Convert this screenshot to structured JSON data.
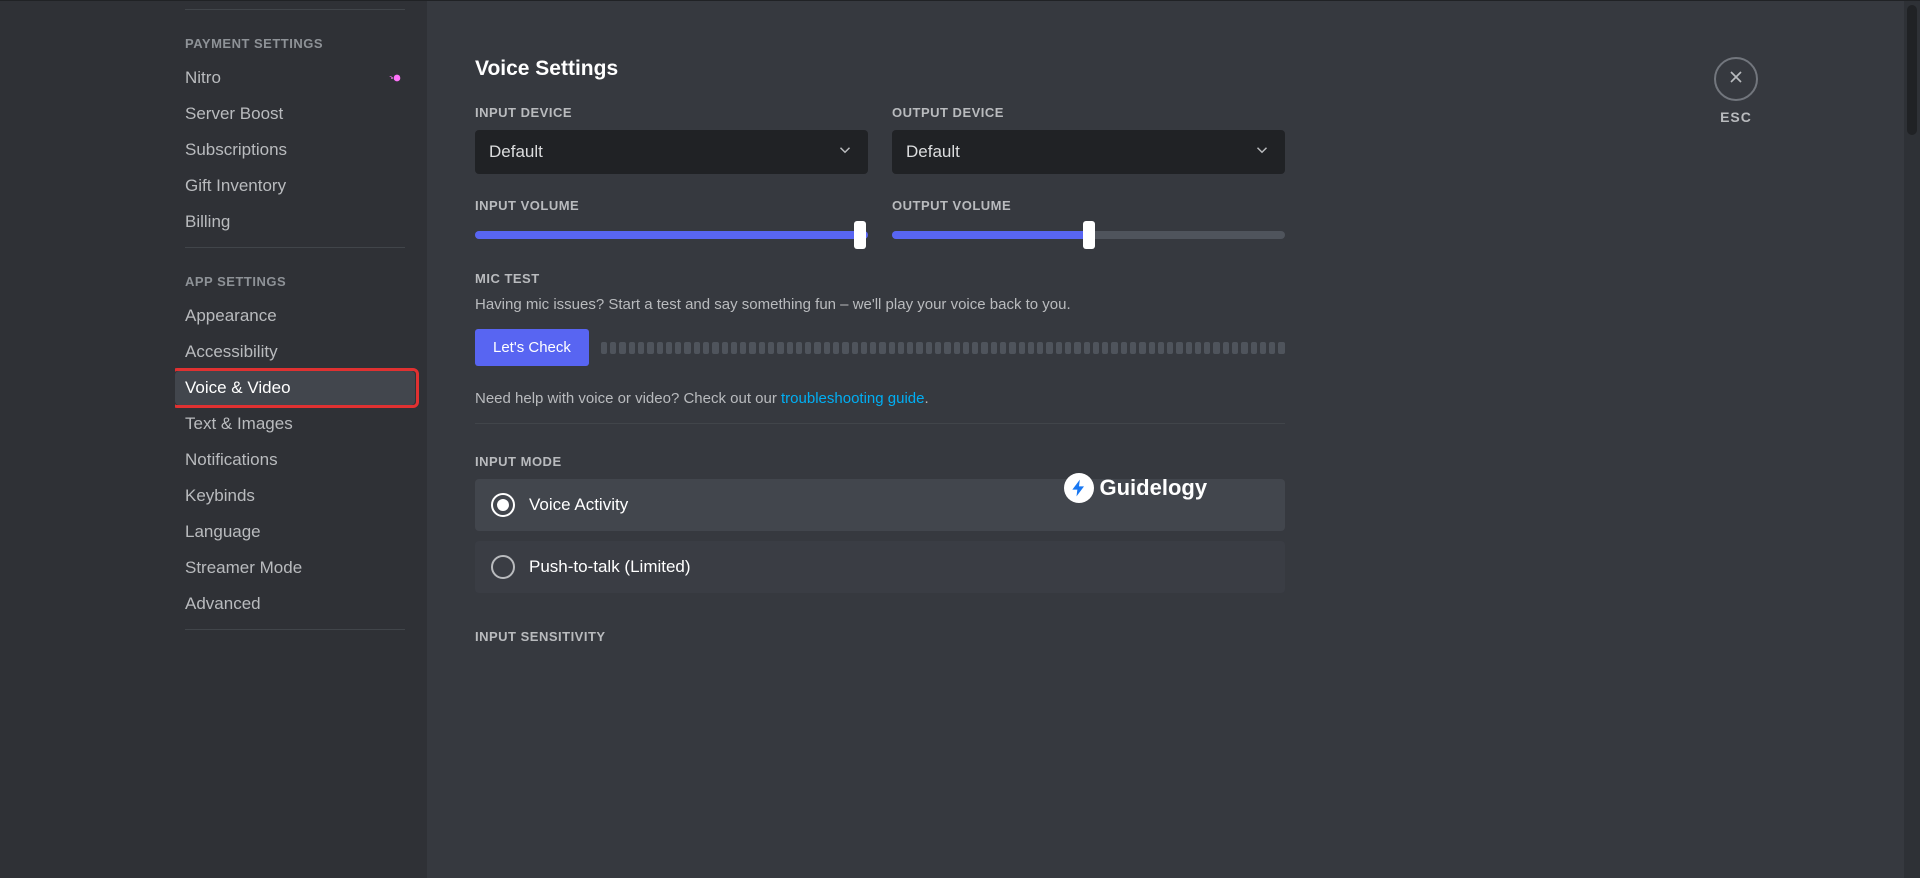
{
  "sidebar": {
    "payment_header": "PAYMENT SETTINGS",
    "app_header": "APP SETTINGS",
    "items": {
      "nitro": "Nitro",
      "server_boost": "Server Boost",
      "subscriptions": "Subscriptions",
      "gift_inventory": "Gift Inventory",
      "billing": "Billing",
      "appearance": "Appearance",
      "accessibility": "Accessibility",
      "voice_video": "Voice & Video",
      "text_images": "Text & Images",
      "notifications": "Notifications",
      "keybinds": "Keybinds",
      "language": "Language",
      "streamer_mode": "Streamer Mode",
      "advanced": "Advanced"
    }
  },
  "page": {
    "title": "Voice Settings",
    "close": "ESC"
  },
  "devices": {
    "input_label": "INPUT DEVICE",
    "input_value": "Default",
    "output_label": "OUTPUT DEVICE",
    "output_value": "Default"
  },
  "volumes": {
    "input_label": "INPUT VOLUME",
    "input_percent": 100,
    "output_label": "OUTPUT VOLUME",
    "output_percent": 50
  },
  "mic_test": {
    "header": "MIC TEST",
    "description": "Having mic issues? Start a test and say something fun – we'll play your voice back to you.",
    "button": "Let's Check"
  },
  "help": {
    "prefix": "Need help with voice or video? Check out our ",
    "link": "troubleshooting guide",
    "suffix": "."
  },
  "input_mode": {
    "header": "INPUT MODE",
    "voice_activity": "Voice Activity",
    "ptt": "Push-to-talk (Limited)",
    "selected": "voice_activity"
  },
  "input_sensitivity": {
    "header": "INPUT SENSITIVITY"
  },
  "watermark": "Guidelogy"
}
